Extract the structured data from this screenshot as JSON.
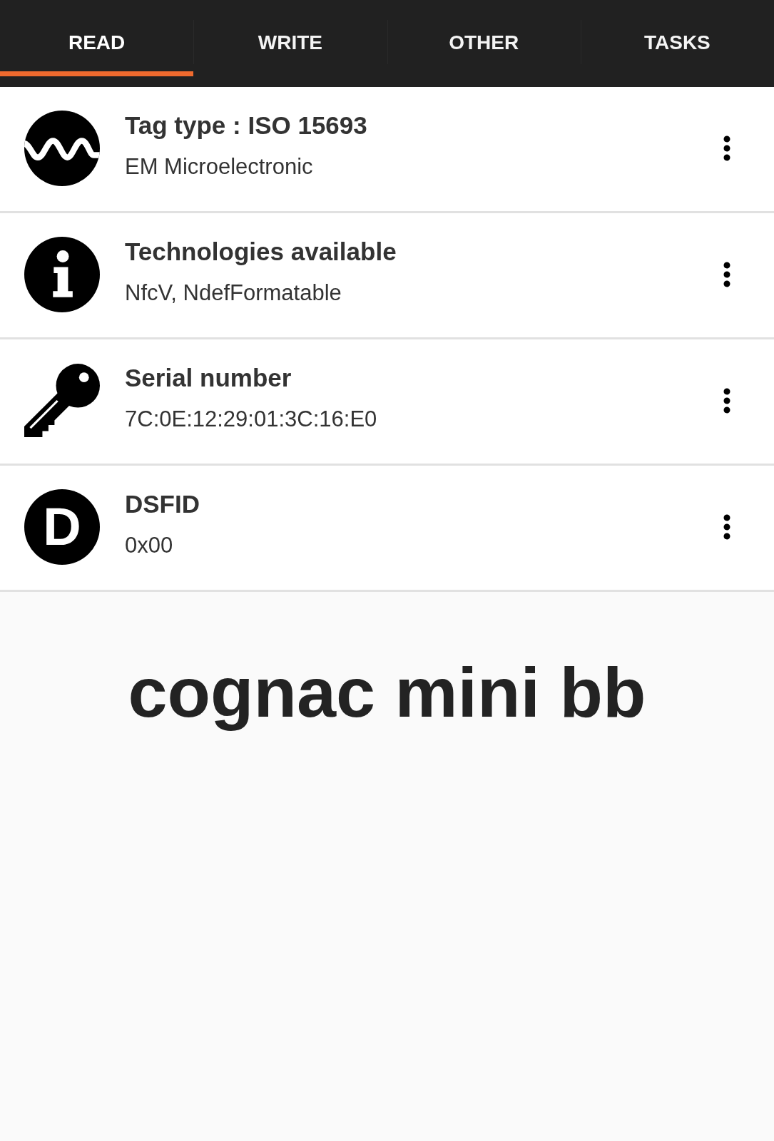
{
  "tabs": [
    {
      "label": "READ",
      "selected": true
    },
    {
      "label": "WRITE",
      "selected": false
    },
    {
      "label": "OTHER",
      "selected": false
    },
    {
      "label": "TASKS",
      "selected": false
    }
  ],
  "records": [
    {
      "kind": "wave",
      "title": "Tag type : ISO 15693",
      "value": "EM Microelectronic"
    },
    {
      "kind": "info",
      "title": "Technologies available",
      "value": "NfcV, NdefFormatable"
    },
    {
      "kind": "key",
      "title": "Serial number",
      "value": "7C:0E:12:29:01:3C:16:E0"
    },
    {
      "kind": "letter",
      "letter": "D",
      "title": "DSFID",
      "value": "0x00"
    }
  ],
  "note": "cognac mini bb"
}
